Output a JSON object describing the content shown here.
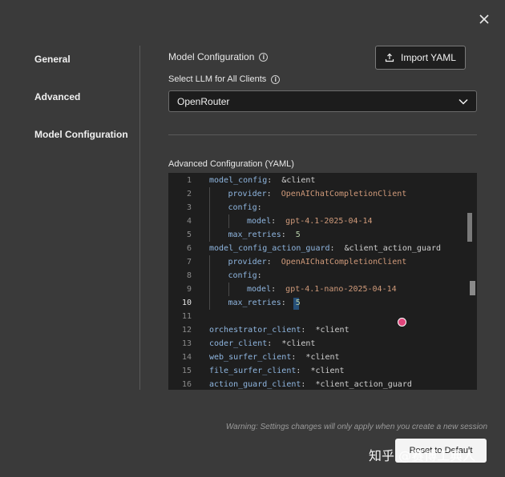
{
  "nav": {
    "items": [
      {
        "label": "General"
      },
      {
        "label": "Advanced"
      },
      {
        "label": "Model Configuration"
      }
    ]
  },
  "header": {
    "title": "Model Configuration",
    "import_label": "Import YAML"
  },
  "llm": {
    "label": "Select LLM for All Clients",
    "selected": "OpenRouter"
  },
  "yaml": {
    "label": "Advanced Configuration (YAML)",
    "lines": [
      {
        "n": "1",
        "key": "model_config",
        "value": "&client"
      },
      {
        "n": "2",
        "key": "provider",
        "value": "OpenAIChatCompletionClient"
      },
      {
        "n": "3",
        "key": "config",
        "value": ""
      },
      {
        "n": "4",
        "key": "model",
        "value": "gpt-4.1-2025-04-14"
      },
      {
        "n": "5",
        "key": "max_retries",
        "value": "5"
      },
      {
        "n": "6",
        "key": "model_config_action_guard",
        "value": "&client_action_guard"
      },
      {
        "n": "7",
        "key": "provider",
        "value": "OpenAIChatCompletionClient"
      },
      {
        "n": "8",
        "key": "config",
        "value": ""
      },
      {
        "n": "9",
        "key": "model",
        "value": "gpt-4.1-nano-2025-04-14"
      },
      {
        "n": "10",
        "key": "max_retries",
        "value": "5"
      },
      {
        "n": "11",
        "key": "",
        "value": ""
      },
      {
        "n": "12",
        "key": "orchestrator_client",
        "value": "*client"
      },
      {
        "n": "13",
        "key": "coder_client",
        "value": "*client"
      },
      {
        "n": "14",
        "key": "web_surfer_client",
        "value": "*client"
      },
      {
        "n": "15",
        "key": "file_surfer_client",
        "value": "*client"
      },
      {
        "n": "16",
        "key": "action_guard_client",
        "value": "*client_action_guard"
      }
    ]
  },
  "footer": {
    "warning": "Warning: Settings changes will only apply when you create a new session",
    "reset_label": "Reset to Default"
  },
  "watermark": "知乎 @赛博工典人",
  "colors": {
    "background": "#3a3a3a",
    "editor_bg": "#1e1e1e",
    "key": "#8fb6e0",
    "string": "#d09a7a",
    "accent_dot": "#e0457b"
  }
}
